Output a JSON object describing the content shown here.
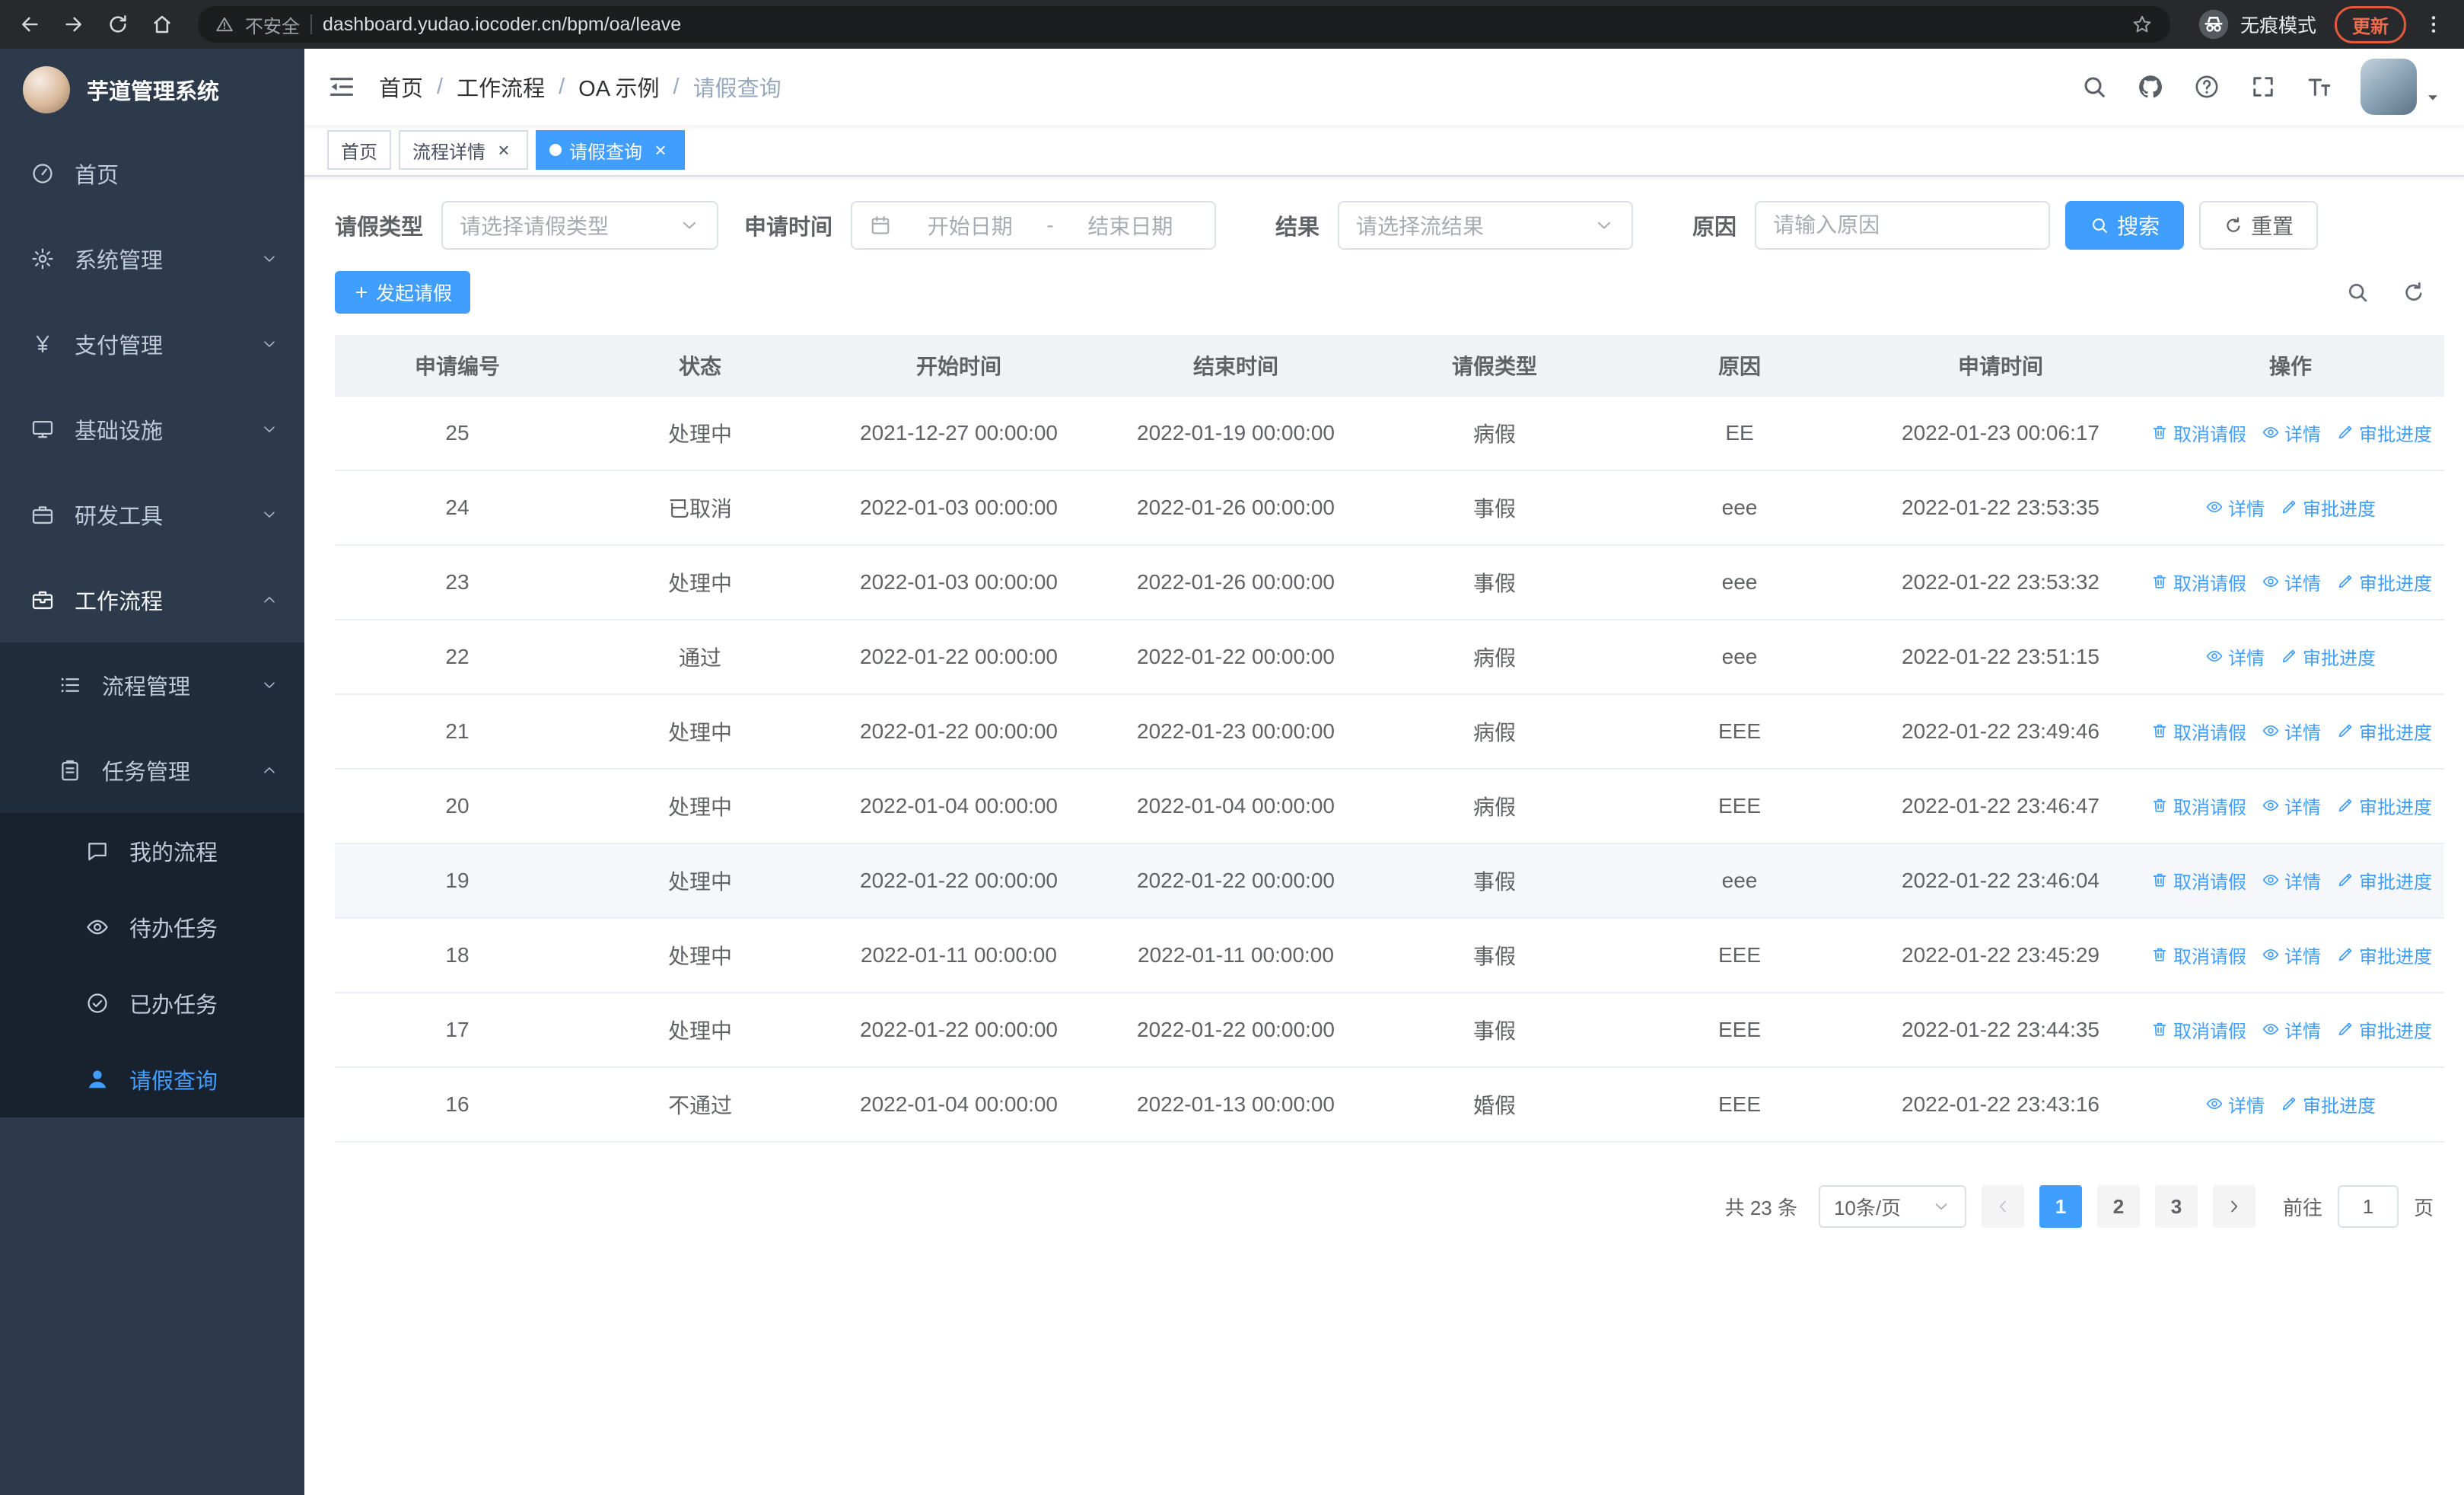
{
  "browser": {
    "nav_icons": [
      "back-icon",
      "forward-icon",
      "reload-icon",
      "home-icon"
    ],
    "security_label": "不安全",
    "url": "dashboard.yudao.iocoder.cn/bpm/oa/leave",
    "incognito_label": "无痕模式",
    "update_label": "更新"
  },
  "sidebar": {
    "logo_title": "芋道管理系统",
    "menu": [
      {
        "key": "home",
        "label": "首页",
        "icon": "dashboard-icon"
      },
      {
        "key": "system",
        "label": "系统管理",
        "icon": "gear-icon",
        "arrow": "down"
      },
      {
        "key": "payment",
        "label": "支付管理",
        "icon": "payment-icon",
        "arrow": "down"
      },
      {
        "key": "infrastructure",
        "label": "基础设施",
        "icon": "monitor-icon",
        "arrow": "down"
      },
      {
        "key": "devtools",
        "label": "研发工具",
        "icon": "briefcase-icon",
        "arrow": "down"
      },
      {
        "key": "workflow",
        "label": "工作流程",
        "icon": "workflow-icon",
        "arrow": "up",
        "open": true
      }
    ],
    "submenu": [
      {
        "key": "process-management",
        "label": "流程管理",
        "icon": "list-icon",
        "arrow": "down",
        "level": 2
      },
      {
        "key": "task-management",
        "label": "任务管理",
        "icon": "clipboard-icon",
        "arrow": "up",
        "level": 2
      },
      {
        "key": "my-process",
        "label": "我的流程",
        "icon": "chat-icon",
        "level": 3
      },
      {
        "key": "todo-tasks",
        "label": "待办任务",
        "icon": "eye-icon",
        "level": 3
      },
      {
        "key": "done-tasks",
        "label": "已办任务",
        "icon": "check-circle-icon",
        "level": 3
      },
      {
        "key": "leave-query",
        "label": "请假查询",
        "icon": "user-icon",
        "level": 3,
        "active": true
      }
    ]
  },
  "header": {
    "breadcrumb": [
      "首页",
      "工作流程",
      "OA 示例",
      "请假查询"
    ],
    "actions": [
      "search-icon",
      "github-icon",
      "help-icon",
      "fullscreen-icon",
      "font-size-icon"
    ]
  },
  "tabs": [
    {
      "key": "home",
      "label": "首页"
    },
    {
      "key": "process-detail",
      "label": "流程详情",
      "closable": true
    },
    {
      "key": "leave-query",
      "label": "请假查询",
      "closable": true,
      "active": true
    }
  ],
  "filters": {
    "leave_type_label": "请假类型",
    "leave_type_placeholder": "请选择请假类型",
    "apply_time_label": "申请时间",
    "start_placeholder": "开始日期",
    "range_separator": "-",
    "end_placeholder": "结束日期",
    "result_label": "结果",
    "result_placeholder": "请选择流结果",
    "reason_label": "原因",
    "reason_placeholder": "请输入原因",
    "search_label": "搜索",
    "reset_label": "重置"
  },
  "toolbar": {
    "create_label": "发起请假"
  },
  "table": {
    "columns": [
      "申请编号",
      "状态",
      "开始时间",
      "结束时间",
      "请假类型",
      "原因",
      "申请时间",
      "操作"
    ],
    "actions": {
      "cancel": "取消请假",
      "detail": "详情",
      "progress": "审批进度"
    },
    "rows": [
      {
        "id": "25",
        "status": "处理中",
        "start": "2021-12-27 00:00:00",
        "end": "2022-01-19 00:00:00",
        "type": "病假",
        "reason": "EE",
        "applied": "2022-01-23 00:06:17",
        "cancelable": true
      },
      {
        "id": "24",
        "status": "已取消",
        "start": "2022-01-03 00:00:00",
        "end": "2022-01-26 00:00:00",
        "type": "事假",
        "reason": "eee",
        "applied": "2022-01-22 23:53:35",
        "cancelable": false
      },
      {
        "id": "23",
        "status": "处理中",
        "start": "2022-01-03 00:00:00",
        "end": "2022-01-26 00:00:00",
        "type": "事假",
        "reason": "eee",
        "applied": "2022-01-22 23:53:32",
        "cancelable": true
      },
      {
        "id": "22",
        "status": "通过",
        "start": "2022-01-22 00:00:00",
        "end": "2022-01-22 00:00:00",
        "type": "病假",
        "reason": "eee",
        "applied": "2022-01-22 23:51:15",
        "cancelable": false
      },
      {
        "id": "21",
        "status": "处理中",
        "start": "2022-01-22 00:00:00",
        "end": "2022-01-23 00:00:00",
        "type": "病假",
        "reason": "EEE",
        "applied": "2022-01-22 23:49:46",
        "cancelable": true
      },
      {
        "id": "20",
        "status": "处理中",
        "start": "2022-01-04 00:00:00",
        "end": "2022-01-04 00:00:00",
        "type": "病假",
        "reason": "EEE",
        "applied": "2022-01-22 23:46:47",
        "cancelable": true
      },
      {
        "id": "19",
        "status": "处理中",
        "start": "2022-01-22 00:00:00",
        "end": "2022-01-22 00:00:00",
        "type": "事假",
        "reason": "eee",
        "applied": "2022-01-22 23:46:04",
        "cancelable": true,
        "highlight": true
      },
      {
        "id": "18",
        "status": "处理中",
        "start": "2022-01-11 00:00:00",
        "end": "2022-01-11 00:00:00",
        "type": "事假",
        "reason": "EEE",
        "applied": "2022-01-22 23:45:29",
        "cancelable": true
      },
      {
        "id": "17",
        "status": "处理中",
        "start": "2022-01-22 00:00:00",
        "end": "2022-01-22 00:00:00",
        "type": "事假",
        "reason": "EEE",
        "applied": "2022-01-22 23:44:35",
        "cancelable": true
      },
      {
        "id": "16",
        "status": "不通过",
        "start": "2022-01-04 00:00:00",
        "end": "2022-01-13 00:00:00",
        "type": "婚假",
        "reason": "EEE",
        "applied": "2022-01-22 23:43:16",
        "cancelable": false
      }
    ]
  },
  "pagination": {
    "total_label": "共 23 条",
    "size_label": "10条/页",
    "pages": [
      {
        "label": "1",
        "active": true
      },
      {
        "label": "2"
      },
      {
        "label": "3"
      }
    ],
    "goto_label": "前往",
    "goto_value": "1",
    "unit_label": "页"
  },
  "colors": {
    "primary": "#409eff",
    "sidebar": "#2d3a4b",
    "table_border": "#ebeef5"
  }
}
